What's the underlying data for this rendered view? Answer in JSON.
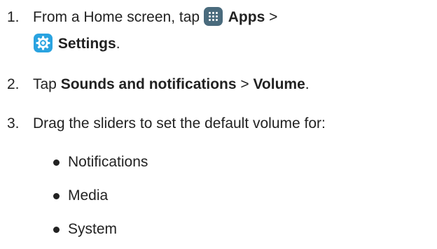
{
  "steps": [
    {
      "number": "1.",
      "text_before": "From a Home screen, tap ",
      "apps_label": "Apps",
      "separator": " >",
      "settings_label": "Settings",
      "end": "."
    },
    {
      "number": "2.",
      "text_before": "Tap ",
      "bold1": "Sounds and notifications",
      "separator": " > ",
      "bold2": "Volume",
      "end": "."
    },
    {
      "number": "3.",
      "text": "Drag the sliders to set the default volume for:"
    }
  ],
  "bullets": [
    "Notifications",
    "Media",
    "System"
  ],
  "icons": {
    "apps": "apps-grid-icon",
    "settings": "settings-gear-icon",
    "apps_color": "#4a6b7d",
    "settings_color": "#2aa3e0"
  }
}
